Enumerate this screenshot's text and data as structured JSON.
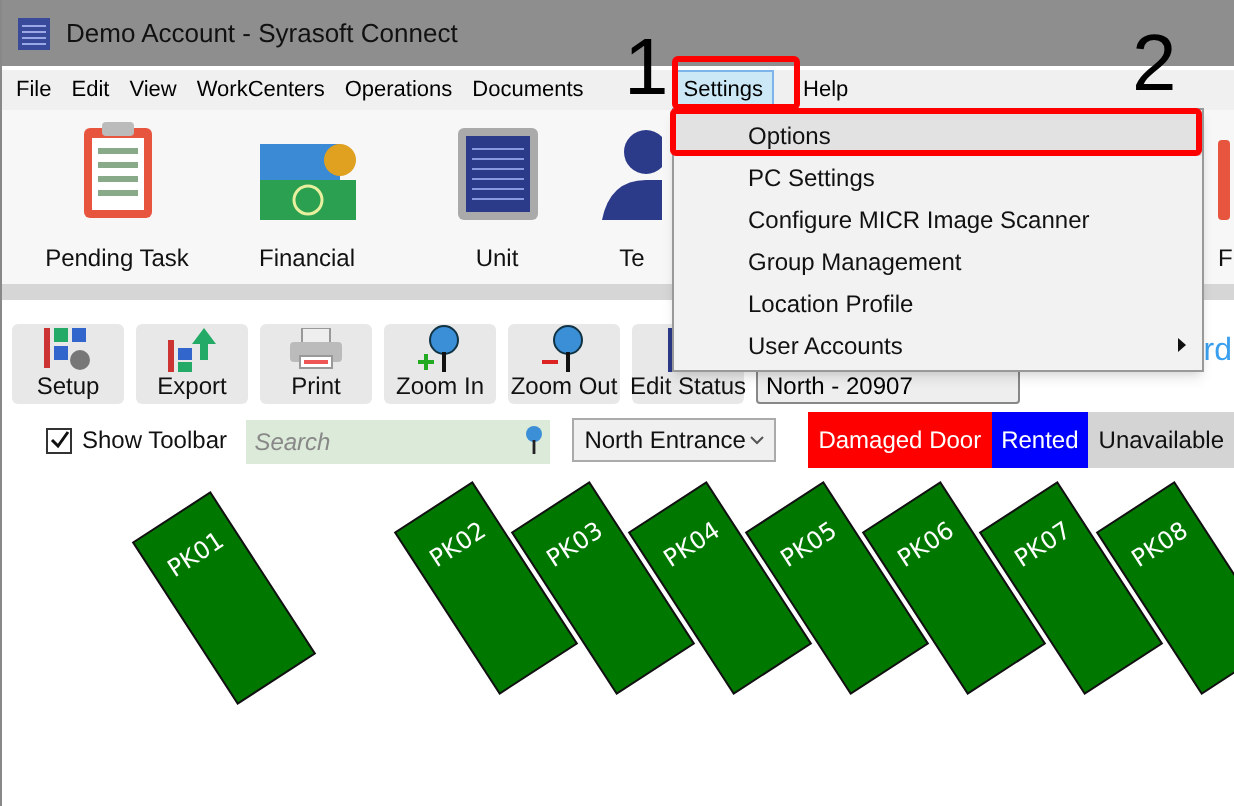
{
  "window": {
    "title": "Demo Account - Syrasoft Connect"
  },
  "menu_bar": [
    {
      "label": "File",
      "selected": false
    },
    {
      "label": "Edit",
      "selected": false
    },
    {
      "label": "View",
      "selected": false
    },
    {
      "label": "WorkCenters",
      "selected": false
    },
    {
      "label": "Operations",
      "selected": false
    },
    {
      "label": "Documents",
      "selected": false
    },
    {
      "label": "Settings",
      "selected": true
    },
    {
      "label": "Help",
      "selected": false
    }
  ],
  "ribbon": [
    {
      "kind": "clipboard",
      "label": "Pending Task"
    },
    {
      "kind": "money",
      "label": "Financial"
    },
    {
      "kind": "unit",
      "label": "Unit"
    },
    {
      "kind": "person",
      "label": "Te"
    },
    {
      "kind": "partial",
      "label": "F"
    }
  ],
  "toolbar": [
    {
      "kind": "setup",
      "label": "Setup"
    },
    {
      "kind": "export",
      "label": "Export"
    },
    {
      "kind": "print",
      "label": "Print"
    },
    {
      "kind": "zoom_in",
      "label": "Zoom In"
    },
    {
      "kind": "zoom_out",
      "label": "Zoom Out"
    },
    {
      "kind": "edit",
      "label": "Edit Status"
    }
  ],
  "location_field": {
    "value": "North - 20907"
  },
  "map_title": "rd",
  "show_toolbar": {
    "label": "Show Toolbar",
    "checked": true
  },
  "search": {
    "placeholder": "Search"
  },
  "entrance_select": {
    "value": "North Entrance"
  },
  "legend": [
    {
      "label": "Damaged Door",
      "color": "#ff0000"
    },
    {
      "label": "Rented",
      "color": "#0000ff"
    },
    {
      "label": "Unavailable",
      "color": "#d4d4d4"
    }
  ],
  "spaces": [
    {
      "label": "PK01",
      "color": "#007800"
    },
    {
      "label": "PK02",
      "color": "#007800"
    },
    {
      "label": "PK03",
      "color": "#007800"
    },
    {
      "label": "PK04",
      "color": "#007800"
    },
    {
      "label": "PK05",
      "color": "#007800"
    },
    {
      "label": "PK06",
      "color": "#007800"
    },
    {
      "label": "PK07",
      "color": "#007800"
    },
    {
      "label": "PK08",
      "color": "#007800"
    }
  ],
  "settings_menu": [
    {
      "label": "Options",
      "selected": true
    },
    {
      "label": "PC Settings",
      "selected": false
    },
    {
      "label": "Configure MICR Image Scanner",
      "selected": false
    },
    {
      "label": "Group Management",
      "selected": false
    },
    {
      "label": "Location Profile",
      "selected": false
    },
    {
      "label": "User Accounts",
      "selected": false,
      "submenu": true
    }
  ],
  "annotations": [
    {
      "label": "1"
    },
    {
      "label": "2"
    }
  ]
}
